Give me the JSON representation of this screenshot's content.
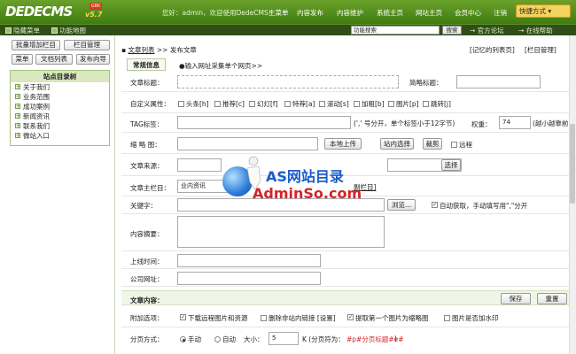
{
  "header": {
    "logo": "DEDECMS",
    "version": "v5.7",
    "badge": "GBK",
    "welcome": "您好：admin，欢迎使用DedeCMS！",
    "nav": [
      "主菜单",
      "内容发布",
      "内容维护",
      "系统主页",
      "网站主页",
      "会员中心",
      "注销"
    ],
    "quick_menu": "快捷方式 ▾"
  },
  "toolbar": {
    "hide_menu": "隐藏菜单",
    "map": "功能地图",
    "search_placeholder": "功能搜索",
    "search_button": "搜索",
    "forum": "官方论坛",
    "help": "在线帮助"
  },
  "sidebar": {
    "buttons": [
      "批量增加栏目",
      "栏目管理",
      "菜单",
      "文档列表",
      "发布向导"
    ],
    "tree_title": "站点目录树",
    "tree_items": [
      "关于我们",
      "业务范围",
      "成功案例",
      "新闻资讯",
      "联系我们",
      "微站入口"
    ]
  },
  "breadcrumb": {
    "list": "文章列表",
    "sep": ">>",
    "current": "发布文章",
    "remember": "[记忆的列表页]",
    "col_manage": "[栏目管理]"
  },
  "tabs": [
    "常规信息",
    "●输入网址采集单个网页>>"
  ],
  "form": {
    "title_label": "文章标题：",
    "short_title_label": "简略标题：",
    "attr_label": "自定义属性：",
    "attrs": [
      "头条[h]",
      "推荐[c]",
      "幻灯[f]",
      "特荐[a]",
      "滚动[s]",
      "加粗[b]",
      "图片[p]",
      "跳转[j]"
    ],
    "tag_label": "TAG标签：",
    "tag_hint": "(',' 号分开，单个标签小于12字节)",
    "weight_label": "权重：",
    "weight_value": "74",
    "weight_hint": "(越小越靠前",
    "thumb_label": "缩 略 图：",
    "local_upload": "本地上传",
    "site_select": "站内选择",
    "crop": "裁剪",
    "remote": "远程",
    "source_label": "文章来源：",
    "select_btn": "选择",
    "column_label": "文章主栏目：",
    "column_value": "业内资讯",
    "column_extra": "副栏目]",
    "keywords_label": "关键字：",
    "browse": "浏览...",
    "auto_fetch": "自动获取，手动填写用\",\"分开",
    "summary_label": "内容摘要：",
    "pubtime_label": "上线时间：",
    "url_label": "公司网址："
  },
  "content_section": {
    "title": "文章内容：",
    "save": "保存",
    "reset": "重置",
    "extra_label": "附加选项：",
    "extra_options": [
      "下载远程图片和资源",
      "删除非站内链接 [设置]",
      "提取第一个图片为缩略图",
      "图片是否加水印"
    ],
    "page_label": "分页方式：",
    "manual": "手动",
    "auto": "自动",
    "size_label": "大小：",
    "size_value": "5",
    "size_unit": "K (分页符为：",
    "page_sep": "#p#分页标题#e#",
    "page_close": ")"
  },
  "watermark": {
    "line1": "AS网站目录",
    "line2": "AdminSo.com"
  },
  "colors": {
    "topbar": "#4f8d1a",
    "accent_red": "#d3242a",
    "accent_blue": "#1c5cc8"
  }
}
